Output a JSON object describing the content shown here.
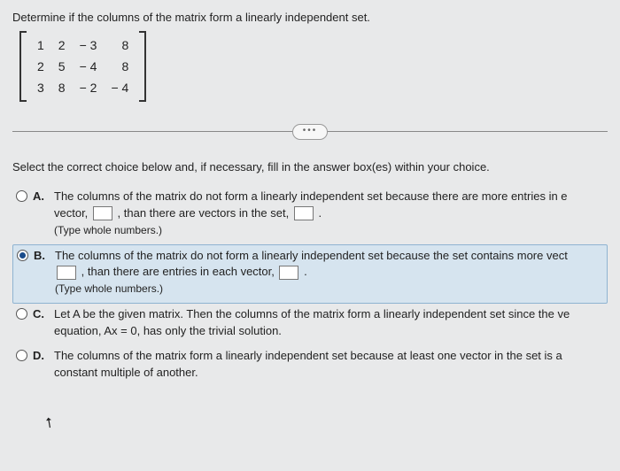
{
  "prompt": "Determine if the columns of the matrix form a linearly independent set.",
  "matrix": {
    "rows": [
      [
        "1",
        "2",
        "− 3",
        "8"
      ],
      [
        "2",
        "5",
        "− 4",
        "8"
      ],
      [
        "3",
        "8",
        "− 2",
        "− 4"
      ]
    ]
  },
  "dots": "•••",
  "instruction": "Select the correct choice below and, if necessary, fill in the answer box(es) within your choice.",
  "choices": {
    "A": {
      "letter": "A.",
      "line1a": "The columns of the matrix do not form a linearly independent set because there are more entries in e",
      "line2a": "vector, ",
      "line2b": ", than there are vectors in the set, ",
      "line2c": ".",
      "hint": "(Type whole numbers.)"
    },
    "B": {
      "letter": "B.",
      "line1a": "The columns of the matrix do not form a linearly independent set because the set contains more vect",
      "line2b": ", than there are entries in each vector, ",
      "line2c": ".",
      "hint": "(Type whole numbers.)"
    },
    "C": {
      "letter": "C.",
      "text": "Let A be the given matrix. Then the columns of the matrix form a linearly independent set since the ve equation, Ax = 0, has only the trivial solution."
    },
    "D": {
      "letter": "D.",
      "text": "The columns of the matrix form a linearly independent set because at least one vector in the set is a constant multiple of another."
    }
  },
  "selected": "B"
}
